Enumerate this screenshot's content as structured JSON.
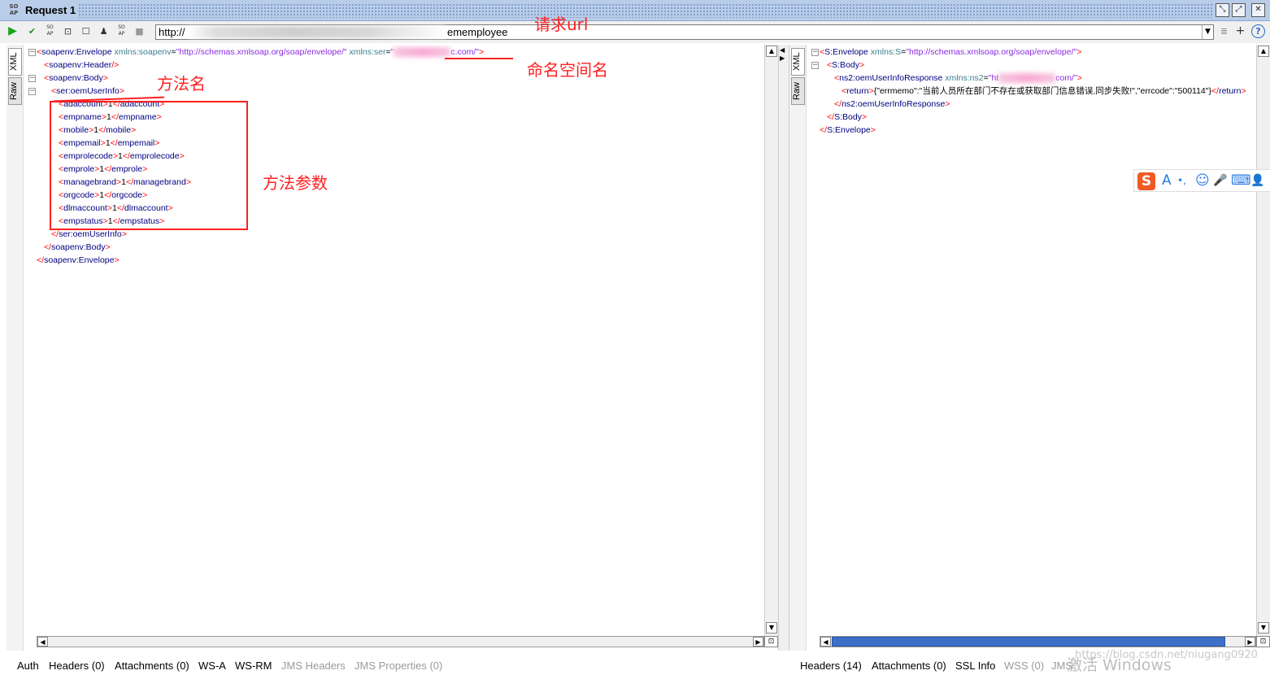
{
  "window": {
    "badge": "SO AP",
    "title": "Request 1",
    "controls": [
      "⤡",
      "⤢",
      "✕"
    ]
  },
  "toolbar": {
    "buttons": [
      {
        "name": "run-request-icon",
        "glyph": "▶"
      },
      {
        "name": "add-assertion-icon",
        "glyph": "✔"
      },
      {
        "name": "soap-request-icon",
        "glyph": "SO AP"
      },
      {
        "name": "create-request-icon",
        "glyph": "⊡"
      },
      {
        "name": "stop-icon",
        "glyph": "☐"
      },
      {
        "name": "user-settings-icon",
        "glyph": "♟"
      },
      {
        "name": "soap-version-icon",
        "glyph": "SO AP"
      },
      {
        "name": "cancel-icon",
        "glyph": "■"
      }
    ],
    "url_prefix": "http://",
    "url_suffix": "ememployee",
    "right_icons": [
      "≣",
      "+",
      "?"
    ]
  },
  "annotations": {
    "url": "请求url",
    "namespace": "命名空间名",
    "method": "方法名",
    "params": "方法参数"
  },
  "left_editor": {
    "tabs": [
      "XML",
      "Raw"
    ],
    "lines": [
      {
        "indent": 0,
        "parts": [
          [
            "br",
            "<"
          ],
          [
            "tag",
            "soapenv:Envelope"
          ],
          [
            "attr",
            " xmlns:soapenv"
          ],
          [
            "txt",
            "="
          ],
          [
            "val",
            "\"http://schemas.xmlsoap.org/soap/envelope/\""
          ],
          [
            "attr",
            " xmlns:ser"
          ],
          [
            "txt",
            "="
          ],
          [
            "val",
            "\""
          ],
          [
            "blur",
            ""
          ],
          [
            "val",
            "c.com/\""
          ],
          [
            "br",
            ">"
          ]
        ]
      },
      {
        "indent": 1,
        "parts": [
          [
            "br",
            "<"
          ],
          [
            "tag",
            "soapenv:Header"
          ],
          [
            "br",
            "/>"
          ]
        ]
      },
      {
        "indent": 1,
        "parts": [
          [
            "br",
            "<"
          ],
          [
            "tag",
            "soapenv:Body"
          ],
          [
            "br",
            ">"
          ]
        ]
      },
      {
        "indent": 2,
        "parts": [
          [
            "br",
            "<"
          ],
          [
            "tag",
            "ser:oemUserInfo"
          ],
          [
            "br",
            ">"
          ]
        ]
      },
      {
        "indent": 3,
        "parts": [
          [
            "br",
            "<"
          ],
          [
            "tag",
            "adaccount"
          ],
          [
            "br",
            ">"
          ],
          [
            "txt",
            "1"
          ],
          [
            "br",
            "</"
          ],
          [
            "tag",
            "adaccount"
          ],
          [
            "br",
            ">"
          ]
        ]
      },
      {
        "indent": 3,
        "parts": [
          [
            "br",
            "<"
          ],
          [
            "tag",
            "empname"
          ],
          [
            "br",
            ">"
          ],
          [
            "txt",
            "1"
          ],
          [
            "br",
            "</"
          ],
          [
            "tag",
            "empname"
          ],
          [
            "br",
            ">"
          ]
        ]
      },
      {
        "indent": 3,
        "parts": [
          [
            "br",
            "<"
          ],
          [
            "tag",
            "mobile"
          ],
          [
            "br",
            ">"
          ],
          [
            "txt",
            "1"
          ],
          [
            "br",
            "</"
          ],
          [
            "tag",
            "mobile"
          ],
          [
            "br",
            ">"
          ]
        ]
      },
      {
        "indent": 3,
        "parts": [
          [
            "br",
            "<"
          ],
          [
            "tag",
            "empemail"
          ],
          [
            "br",
            ">"
          ],
          [
            "txt",
            "1"
          ],
          [
            "br",
            "</"
          ],
          [
            "tag",
            "empemail"
          ],
          [
            "br",
            ">"
          ]
        ]
      },
      {
        "indent": 3,
        "parts": [
          [
            "br",
            "<"
          ],
          [
            "tag",
            "emprolecode"
          ],
          [
            "br",
            ">"
          ],
          [
            "txt",
            "1"
          ],
          [
            "br",
            "</"
          ],
          [
            "tag",
            "emprolecode"
          ],
          [
            "br",
            ">"
          ]
        ]
      },
      {
        "indent": 3,
        "parts": [
          [
            "br",
            "<"
          ],
          [
            "tag",
            "emprole"
          ],
          [
            "br",
            ">"
          ],
          [
            "txt",
            "1"
          ],
          [
            "br",
            "</"
          ],
          [
            "tag",
            "emprole"
          ],
          [
            "br",
            ">"
          ]
        ]
      },
      {
        "indent": 3,
        "parts": [
          [
            "br",
            "<"
          ],
          [
            "tag",
            "managebrand"
          ],
          [
            "br",
            ">"
          ],
          [
            "txt",
            "1"
          ],
          [
            "br",
            "</"
          ],
          [
            "tag",
            "managebrand"
          ],
          [
            "br",
            ">"
          ]
        ]
      },
      {
        "indent": 3,
        "parts": [
          [
            "br",
            "<"
          ],
          [
            "tag",
            "orgcode"
          ],
          [
            "br",
            ">"
          ],
          [
            "txt",
            "1"
          ],
          [
            "br",
            "</"
          ],
          [
            "tag",
            "orgcode"
          ],
          [
            "br",
            ">"
          ]
        ]
      },
      {
        "indent": 3,
        "parts": [
          [
            "br",
            "<"
          ],
          [
            "tag",
            "dlmaccount"
          ],
          [
            "br",
            ">"
          ],
          [
            "txt",
            "1"
          ],
          [
            "br",
            "</"
          ],
          [
            "tag",
            "dlmaccount"
          ],
          [
            "br",
            ">"
          ]
        ]
      },
      {
        "indent": 3,
        "parts": [
          [
            "br",
            "<"
          ],
          [
            "tag",
            "empstatus"
          ],
          [
            "br",
            ">"
          ],
          [
            "txt",
            "1"
          ],
          [
            "br",
            "</"
          ],
          [
            "tag",
            "empstatus"
          ],
          [
            "br",
            ">"
          ]
        ]
      },
      {
        "indent": 2,
        "parts": [
          [
            "br",
            "</"
          ],
          [
            "tag",
            "ser:oemUserInfo"
          ],
          [
            "br",
            ">"
          ]
        ]
      },
      {
        "indent": 1,
        "parts": [
          [
            "br",
            "</"
          ],
          [
            "tag",
            "soapenv:Body"
          ],
          [
            "br",
            ">"
          ]
        ]
      },
      {
        "indent": 0,
        "parts": [
          [
            "br",
            "</"
          ],
          [
            "tag",
            "soapenv:Envelope"
          ],
          [
            "br",
            ">"
          ]
        ]
      }
    ]
  },
  "right_editor": {
    "tabs": [
      "XML",
      "Raw"
    ],
    "lines": [
      {
        "indent": 0,
        "parts": [
          [
            "br",
            "<"
          ],
          [
            "tag",
            "S:Envelope"
          ],
          [
            "attr",
            " xmlns:S"
          ],
          [
            "txt",
            "="
          ],
          [
            "val",
            "\"http://schemas.xmlsoap.org/soap/envelope/\""
          ],
          [
            "br",
            ">"
          ]
        ]
      },
      {
        "indent": 1,
        "parts": [
          [
            "br",
            "<"
          ],
          [
            "tag",
            "S:Body"
          ],
          [
            "br",
            ">"
          ]
        ]
      },
      {
        "indent": 2,
        "parts": [
          [
            "br",
            "<"
          ],
          [
            "tag",
            "ns2:oemUserInfoResponse"
          ],
          [
            "attr",
            " xmlns:ns2"
          ],
          [
            "txt",
            "="
          ],
          [
            "val",
            "\"ht"
          ],
          [
            "blur",
            ""
          ],
          [
            "val",
            "com/\""
          ],
          [
            "br",
            ">"
          ]
        ]
      },
      {
        "indent": 3,
        "parts": [
          [
            "br",
            "<"
          ],
          [
            "tag",
            "return"
          ],
          [
            "br",
            ">"
          ],
          [
            "txt",
            "{\"errmemo\":\"当前人员所在部门不存在或获取部门信息错误,同步失败!\",\"errcode\":\"500114\"}"
          ],
          [
            "br",
            "</"
          ],
          [
            "tag",
            "return"
          ],
          [
            "br",
            ">"
          ]
        ]
      },
      {
        "indent": 2,
        "parts": [
          [
            "br",
            "</"
          ],
          [
            "tag",
            "ns2:oemUserInfoResponse"
          ],
          [
            "br",
            ">"
          ]
        ]
      },
      {
        "indent": 1,
        "parts": [
          [
            "br",
            "</"
          ],
          [
            "tag",
            "S:Body"
          ],
          [
            "br",
            ">"
          ]
        ]
      },
      {
        "indent": 0,
        "parts": [
          [
            "br",
            "</"
          ],
          [
            "tag",
            "S:Envelope"
          ],
          [
            "br",
            ">"
          ]
        ]
      }
    ]
  },
  "left_bottom_tabs": [
    {
      "label": "Auth",
      "enabled": true
    },
    {
      "label": "Headers (0)",
      "enabled": true
    },
    {
      "label": "Attachments (0)",
      "enabled": true
    },
    {
      "label": "WS-A",
      "enabled": true
    },
    {
      "label": "WS-RM",
      "enabled": true
    },
    {
      "label": "JMS Headers",
      "enabled": false
    },
    {
      "label": "JMS Properties (0)",
      "enabled": false
    }
  ],
  "right_bottom_tabs": [
    {
      "label": "Headers (14)",
      "enabled": true
    },
    {
      "label": "Attachments (0)",
      "enabled": true
    },
    {
      "label": "SSL Info",
      "enabled": true
    },
    {
      "label": "WSS (0)",
      "enabled": false
    },
    {
      "label": "JMS",
      "enabled": false
    }
  ],
  "ime_toolbar": [
    "S",
    "A",
    "•,",
    "☺",
    "🎤",
    "⌨",
    "👤"
  ],
  "watermark": {
    "windows": "激活 Windows",
    "blog": "https://blog.csdn.net/niugang0920"
  }
}
